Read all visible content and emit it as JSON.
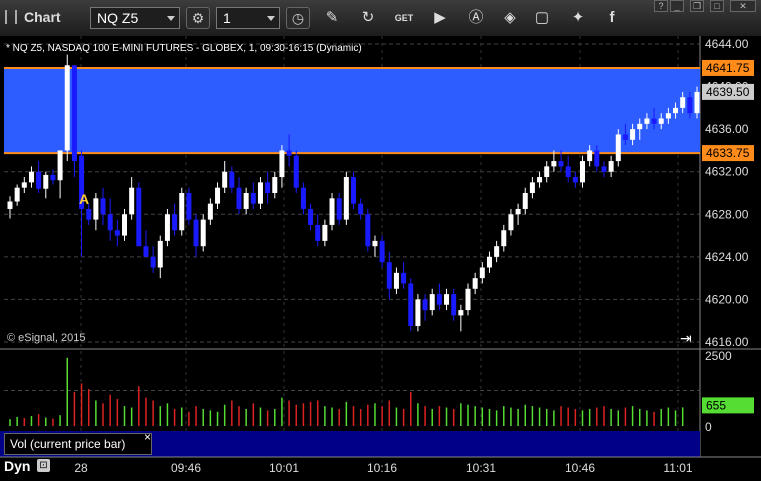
{
  "window": {
    "title": "Chart"
  },
  "toolbar": {
    "symbol": "NQ Z5",
    "interval": "1",
    "icons": [
      "settings-gear-icon",
      "clock-icon",
      "pencil-icon",
      "refresh-icon",
      "get-icon",
      "play-icon",
      "a-annotation-icon",
      "tag-icon",
      "comment-icon",
      "twitter-icon",
      "facebook-icon"
    ]
  },
  "chart_info": "* NQ Z5, NASDAQ 100 E-MINI FUTURES - GLOBEX, 1, 09:30-16:15 (Dynamic)",
  "copyright": "© eSignal, 2015",
  "annotation_letter": "A",
  "volume_panel_label": "Vol (current price bar)",
  "status": {
    "mode": "Dyn"
  },
  "colors": {
    "up": "#ffffff",
    "down": "#1a1aff",
    "band": "#2d5cff",
    "band_line": "#ff8c1a",
    "vol_up": "#55dd33",
    "vol_down": "#dd2222",
    "grid": "#444444",
    "vol_bg": "#000088"
  },
  "chart_data": {
    "type": "candlestick",
    "price_axis": {
      "ticks": [
        "4644.00",
        "4640.00",
        "4636.00",
        "4632.00",
        "4628.00",
        "4624.00",
        "4620.00",
        "4616.00"
      ],
      "ylim": [
        4616,
        4644
      ]
    },
    "band": {
      "high": 4641.75,
      "low": 4633.75,
      "high_label": "4641.75",
      "low_label": "4633.75"
    },
    "last_price": {
      "value": 4639.5,
      "label": "4639.50"
    },
    "volume_axis": {
      "ticks": [
        "2500",
        "0"
      ],
      "ylim": [
        0,
        2500
      ]
    },
    "last_volume": {
      "value": 655,
      "label": "655"
    },
    "x_labels": [
      "28",
      "09:46",
      "10:01",
      "10:16",
      "10:31",
      "10:46",
      "11:01"
    ],
    "candles": [
      [
        4628.5,
        4629.7,
        4627.6,
        4629.2
      ],
      [
        4629.2,
        4630.8,
        4628.8,
        4630.5
      ],
      [
        4630.5,
        4631.5,
        4630.0,
        4631.0
      ],
      [
        4631.0,
        4632.5,
        4630.5,
        4632.0
      ],
      [
        4632.0,
        4633.0,
        4630.0,
        4630.4
      ],
      [
        4630.4,
        4632.0,
        4629.5,
        4631.7
      ],
      [
        4631.7,
        4632.2,
        4630.8,
        4631.2
      ],
      [
        4631.2,
        4633.5,
        4629.5,
        4634.0
      ],
      [
        4634.0,
        4643.0,
        4633.0,
        4642.0
      ],
      [
        4642.0,
        4642.0,
        4631.5,
        4633.0
      ],
      [
        4633.5,
        4634.0,
        4624.0,
        4628.5
      ],
      [
        4628.5,
        4629.0,
        4627.0,
        4627.5
      ],
      [
        4627.5,
        4630.0,
        4626.5,
        4629.5
      ],
      [
        4629.5,
        4630.5,
        4627.0,
        4628.0
      ],
      [
        4628.0,
        4629.5,
        4625.5,
        4626.5
      ],
      [
        4626.5,
        4627.5,
        4625.0,
        4626.0
      ],
      [
        4626.0,
        4628.5,
        4625.5,
        4628.0
      ],
      [
        4628.0,
        4631.5,
        4627.5,
        4630.5
      ],
      [
        4630.5,
        4631.0,
        4625.0,
        4625.0
      ],
      [
        4625.0,
        4626.5,
        4624.0,
        4624.0
      ],
      [
        4624.0,
        4625.0,
        4622.5,
        4623.0
      ],
      [
        4623.0,
        4626.0,
        4622.0,
        4625.5
      ],
      [
        4625.5,
        4628.5,
        4625.0,
        4628.0
      ],
      [
        4628.0,
        4629.0,
        4626.0,
        4626.5
      ],
      [
        4626.5,
        4630.5,
        4626.0,
        4630.0
      ],
      [
        4630.0,
        4630.5,
        4627.0,
        4627.5
      ],
      [
        4627.5,
        4628.0,
        4624.0,
        4625.0
      ],
      [
        4625.0,
        4628.0,
        4624.5,
        4627.5
      ],
      [
        4627.5,
        4629.5,
        4627.0,
        4629.0
      ],
      [
        4629.0,
        4631.0,
        4628.5,
        4630.5
      ],
      [
        4630.5,
        4633.0,
        4630.0,
        4632.0
      ],
      [
        4632.0,
        4632.5,
        4630.0,
        4630.5
      ],
      [
        4630.5,
        4631.5,
        4628.0,
        4628.5
      ],
      [
        4628.5,
        4630.5,
        4628.0,
        4630.0
      ],
      [
        4630.0,
        4631.0,
        4628.5,
        4629.0
      ],
      [
        4629.0,
        4631.5,
        4628.5,
        4631.0
      ],
      [
        4631.0,
        4632.0,
        4629.0,
        4630.0
      ],
      [
        4630.0,
        4632.0,
        4629.5,
        4631.5
      ],
      [
        4631.5,
        4634.5,
        4630.5,
        4634.0
      ],
      [
        4634.0,
        4635.5,
        4632.5,
        4633.5
      ],
      [
        4633.5,
        4634.0,
        4630.0,
        4630.5
      ],
      [
        4630.5,
        4631.0,
        4628.0,
        4628.5
      ],
      [
        4628.5,
        4629.0,
        4626.5,
        4627.0
      ],
      [
        4627.0,
        4628.0,
        4625.0,
        4625.5
      ],
      [
        4625.5,
        4627.5,
        4625.0,
        4627.0
      ],
      [
        4627.0,
        4630.0,
        4626.5,
        4629.5
      ],
      [
        4629.5,
        4630.0,
        4627.0,
        4627.5
      ],
      [
        4627.5,
        4632.0,
        4627.0,
        4631.5
      ],
      [
        4631.5,
        4632.0,
        4628.5,
        4629.0
      ],
      [
        4629.0,
        4629.5,
        4627.5,
        4628.0
      ],
      [
        4628.0,
        4628.5,
        4624.5,
        4625.0
      ],
      [
        4625.0,
        4626.0,
        4624.0,
        4625.5
      ],
      [
        4625.5,
        4626.0,
        4623.0,
        4623.5
      ],
      [
        4623.5,
        4624.5,
        4620.0,
        4621.0
      ],
      [
        4621.0,
        4623.0,
        4620.5,
        4622.5
      ],
      [
        4622.5,
        4623.5,
        4621.0,
        4621.5
      ],
      [
        4621.5,
        4622.0,
        4617.0,
        4617.5
      ],
      [
        4617.5,
        4620.5,
        4617.0,
        4620.0
      ],
      [
        4620.0,
        4620.5,
        4618.0,
        4619.0
      ],
      [
        4619.0,
        4621.0,
        4618.5,
        4620.5
      ],
      [
        4620.5,
        4621.5,
        4619.0,
        4619.5
      ],
      [
        4619.5,
        4621.0,
        4619.0,
        4620.5
      ],
      [
        4620.5,
        4621.0,
        4618.0,
        4618.5
      ],
      [
        4618.5,
        4619.5,
        4617.0,
        4619.0
      ],
      [
        4619.0,
        4621.5,
        4618.5,
        4621.0
      ],
      [
        4621.0,
        4622.5,
        4620.5,
        4622.0
      ],
      [
        4622.0,
        4623.5,
        4621.5,
        4623.0
      ],
      [
        4623.0,
        4624.5,
        4622.5,
        4624.0
      ],
      [
        4624.0,
        4625.5,
        4623.5,
        4625.0
      ],
      [
        4625.0,
        4627.0,
        4624.5,
        4626.5
      ],
      [
        4626.5,
        4628.5,
        4626.0,
        4628.0
      ],
      [
        4628.0,
        4629.0,
        4627.0,
        4628.5
      ],
      [
        4628.5,
        4630.5,
        4628.0,
        4630.0
      ],
      [
        4630.0,
        4631.5,
        4629.5,
        4631.0
      ],
      [
        4631.0,
        4632.0,
        4630.5,
        4631.5
      ],
      [
        4631.5,
        4633.0,
        4631.0,
        4632.5
      ],
      [
        4632.5,
        4634.0,
        4632.0,
        4633.0
      ],
      [
        4633.0,
        4634.0,
        4632.0,
        4632.5
      ],
      [
        4632.5,
        4633.5,
        4631.0,
        4631.5
      ],
      [
        4631.5,
        4632.0,
        4630.5,
        4631.0
      ],
      [
        4631.0,
        4633.5,
        4630.5,
        4633.0
      ],
      [
        4633.0,
        4634.5,
        4632.5,
        4634.0
      ],
      [
        4634.0,
        4634.5,
        4632.0,
        4632.5
      ],
      [
        4632.5,
        4633.0,
        4631.5,
        4632.0
      ],
      [
        4632.0,
        4633.5,
        4631.5,
        4633.0
      ],
      [
        4633.0,
        4636.0,
        4632.5,
        4635.5
      ],
      [
        4635.5,
        4636.5,
        4634.5,
        4635.0
      ],
      [
        4635.0,
        4636.5,
        4634.5,
        4636.0
      ],
      [
        4636.0,
        4637.0,
        4635.0,
        4636.5
      ],
      [
        4636.5,
        4637.5,
        4636.0,
        4637.0
      ],
      [
        4637.0,
        4638.0,
        4636.0,
        4636.5
      ],
      [
        4636.5,
        4637.5,
        4636.0,
        4637.0
      ],
      [
        4637.0,
        4638.0,
        4636.5,
        4637.5
      ],
      [
        4637.5,
        4638.5,
        4637.0,
        4638.0
      ],
      [
        4638.0,
        4639.5,
        4637.5,
        4639.0
      ],
      [
        4639.0,
        4639.5,
        4637.0,
        4637.5
      ],
      [
        4637.5,
        4640.0,
        4637.0,
        4639.5
      ]
    ],
    "volumes": [
      240,
      320,
      280,
      350,
      420,
      300,
      260,
      380,
      2400,
      1200,
      1500,
      1300,
      900,
      800,
      1100,
      950,
      700,
      650,
      1400,
      1000,
      900,
      700,
      800,
      600,
      650,
      500,
      700,
      600,
      550,
      500,
      750,
      900,
      700,
      600,
      800,
      650,
      550,
      600,
      1000,
      900,
      750,
      800,
      850,
      900,
      700,
      650,
      600,
      850,
      700,
      600,
      750,
      800,
      700,
      900,
      650,
      600,
      1200,
      800,
      700,
      600,
      700,
      650,
      600,
      800,
      750,
      700,
      650,
      600,
      550,
      700,
      650,
      600,
      750,
      700,
      650,
      600,
      550,
      700,
      650,
      600,
      550,
      600,
      650,
      700,
      600,
      550,
      650,
      700,
      600,
      550,
      500,
      600,
      650,
      550,
      655
    ],
    "volume_colors": "u,u,d,u,d,u,d,u,u,d,d,d,u,d,d,d,u,u,d,d,d,u,u,d,u,d,d,u,u,u,u,d,d,u,d,u,d,u,u,d,d,d,d,d,u,u,d,u,d,d,d,u,d,d,u,d,d,u,d,u,d,u,d,u,u,u,u,u,u,u,u,u,u,u,u,u,u,d,d,d,u,u,d,d,u,u,d,u,u,u,d,u,u,u,u,d,u"
  }
}
